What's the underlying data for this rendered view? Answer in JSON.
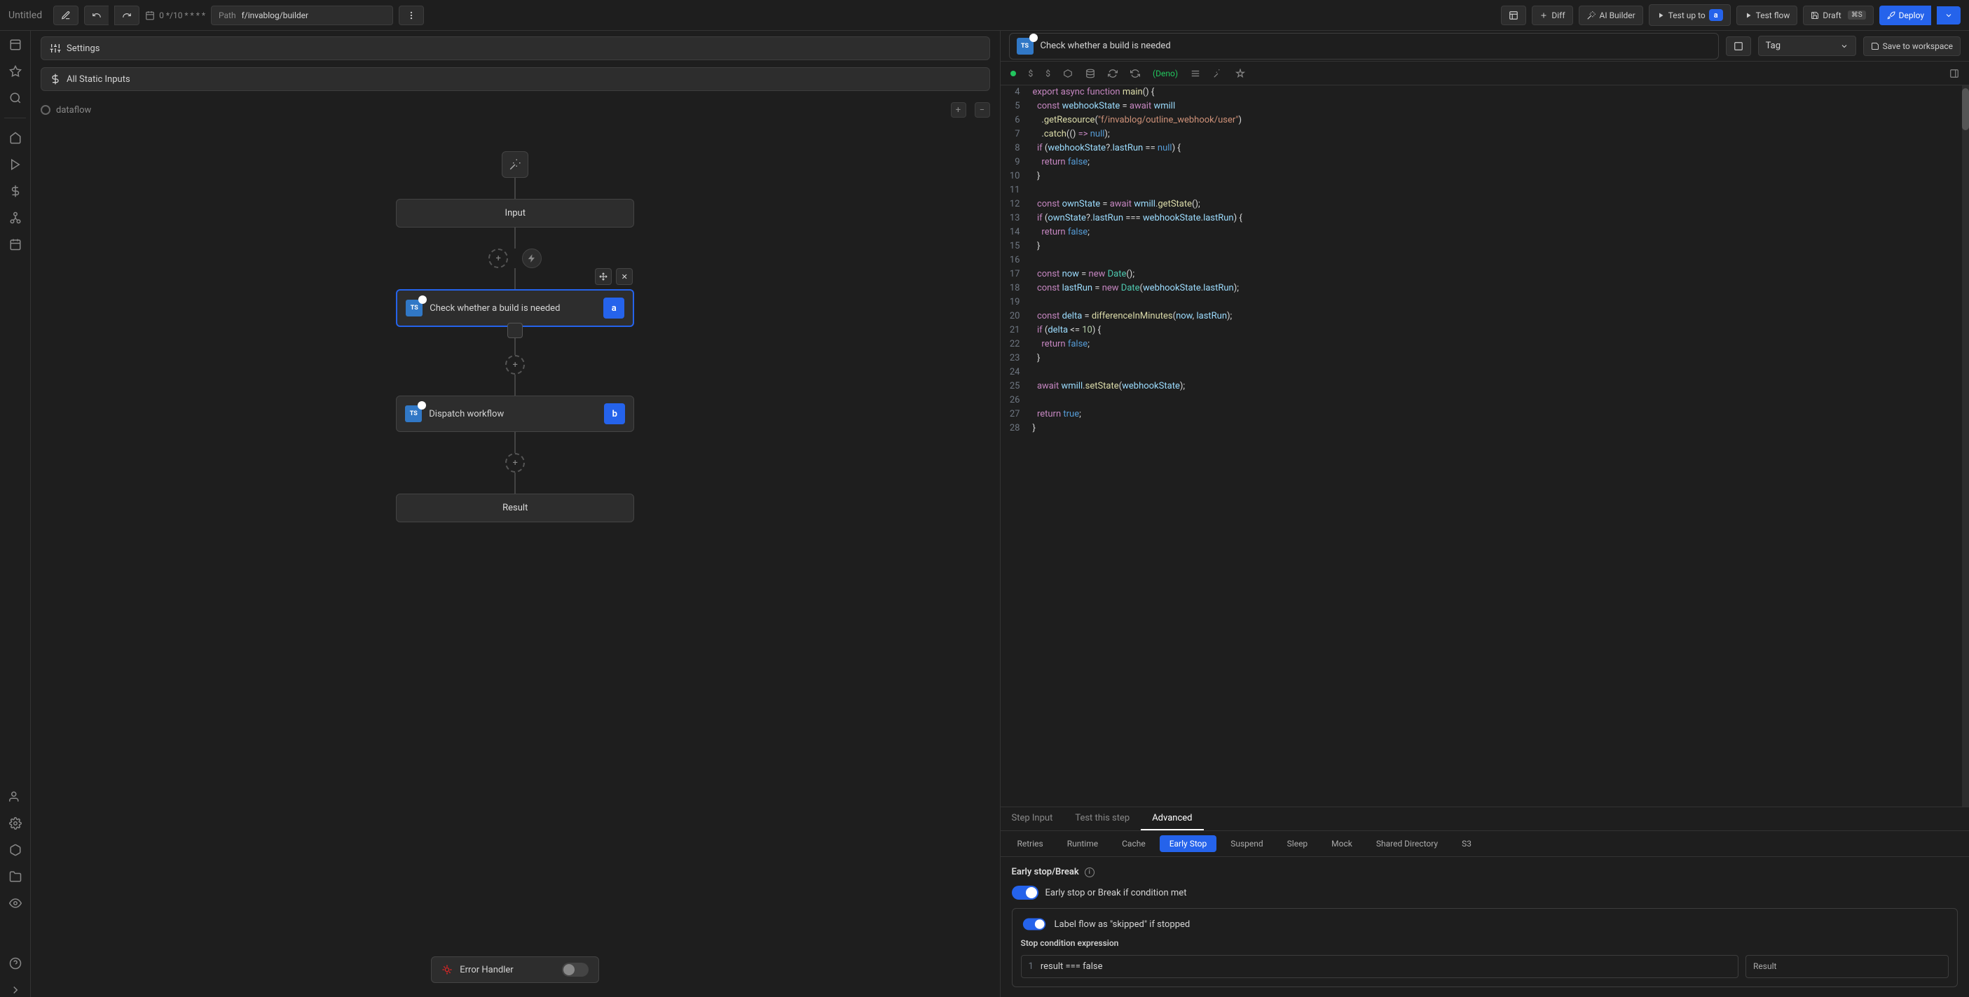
{
  "topbar": {
    "title": "Untitled",
    "schedule": "0 */10 * * * *",
    "path_label": "Path",
    "path_value": "f/invablog/builder",
    "diff": "Diff",
    "ai_builder": "AI Builder",
    "test_up_to": "Test up to",
    "test_up_to_badge": "a",
    "test_flow": "Test flow",
    "draft": "Draft",
    "draft_kbd": "⌘S",
    "deploy": "Deploy"
  },
  "left_panel": {
    "settings": "Settings",
    "all_static": "All Static Inputs",
    "dataflow": "dataflow"
  },
  "canvas": {
    "input_label": "Input",
    "step_a_label": "Check whether a build is needed",
    "step_a_letter": "a",
    "step_b_label": "Dispatch workflow",
    "step_b_letter": "b",
    "result_label": "Result",
    "error_handler": "Error Handler"
  },
  "right_header": {
    "step_title": "Check whether a build is needed",
    "tag_label": "Tag",
    "save_workspace": "Save to workspace"
  },
  "editor_toolbar": {
    "runtime": "(Deno)"
  },
  "code": {
    "lines": [
      "4",
      "5",
      "6",
      "7",
      "8",
      "9",
      "10",
      "11",
      "12",
      "13",
      "14",
      "15",
      "16",
      "17",
      "18",
      "19",
      "20",
      "21",
      "22",
      "23",
      "24",
      "25",
      "26",
      "27",
      "28"
    ],
    "l4": "export async function main() {",
    "l5": "  const webhookState = await wmill",
    "l6": "    .getResource(\"f/invablog/outline_webhook/user\")",
    "l7": "    .catch(() => null);",
    "l8": "  if (webhookState?.lastRun == null) {",
    "l9": "    return false;",
    "l10": "  }",
    "l11": "",
    "l12": "  const ownState = await wmill.getState();",
    "l13": "  if (ownState?.lastRun === webhookState.lastRun) {",
    "l14": "    return false;",
    "l15": "  }",
    "l16": "",
    "l17": "  const now = new Date();",
    "l18": "  const lastRun = new Date(webhookState.lastRun);",
    "l19": "",
    "l20": "  const delta = differenceInMinutes(now, lastRun);",
    "l21": "  if (delta <= 10) {",
    "l22": "    return false;",
    "l23": "  }",
    "l24": "",
    "l25": "  await wmill.setState(webhookState);",
    "l26": "",
    "l27": "  return true;",
    "l28": "}"
  },
  "tabs": {
    "step_input": "Step Input",
    "test_step": "Test this step",
    "advanced": "Advanced"
  },
  "subtabs": {
    "retries": "Retries",
    "runtime": "Runtime",
    "cache": "Cache",
    "early_stop": "Early Stop",
    "suspend": "Suspend",
    "sleep": "Sleep",
    "mock": "Mock",
    "shared_dir": "Shared Directory",
    "s3": "S3"
  },
  "early_stop": {
    "title": "Early stop/Break",
    "toggle_label": "Early stop or Break if condition met",
    "label_skipped": "Label flow as \"skipped\" if stopped",
    "stop_cond_label": "Stop condition expression",
    "expr_line_no": "1",
    "expr": "result === false",
    "result_label": "Result"
  }
}
